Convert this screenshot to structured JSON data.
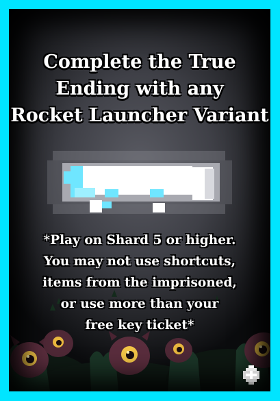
{
  "card": {
    "title_lines": [
      "Complete the True",
      "Ending with any",
      "Rocket Launcher Variant"
    ],
    "condition_lines": [
      "*Play on Shard 5 or higher.",
      "You may not use shortcuts,",
      "items from the imprisoned,",
      "or use more than your",
      "free key ticket*"
    ],
    "item_icon": "rocket-launcher-icon",
    "corner_icon": "diamond-shard-icon",
    "colors": {
      "border": "#00e5ff",
      "background": "#3f4047",
      "text": "#ffffff",
      "item_glow": "#6fe6ff"
    }
  }
}
